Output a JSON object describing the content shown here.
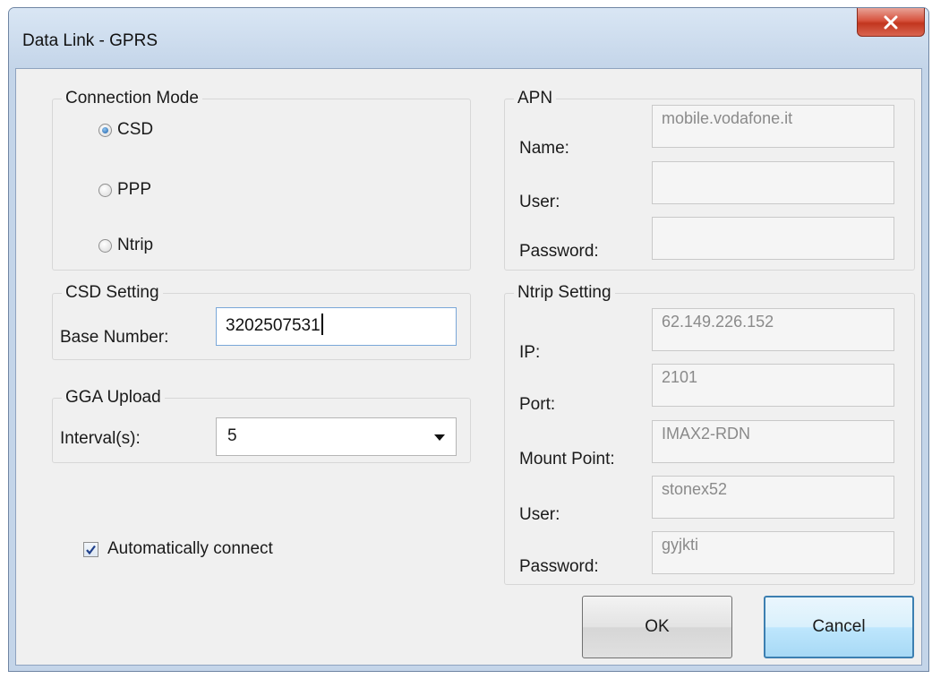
{
  "window": {
    "title": "Data Link - GPRS",
    "close_label": "x"
  },
  "connection_mode": {
    "title": "Connection Mode",
    "options": [
      {
        "label": "CSD",
        "checked": true
      },
      {
        "label": "PPP",
        "checked": false
      },
      {
        "label": "Ntrip",
        "checked": false
      }
    ]
  },
  "csd_setting": {
    "title": "CSD Setting",
    "base_number_label": "Base Number:",
    "base_number_value": "3202507531"
  },
  "gga_upload": {
    "title": "GGA Upload",
    "interval_label": "Interval(s):",
    "interval_value": "5"
  },
  "auto_connect": {
    "label": "Automatically connect",
    "checked": true
  },
  "apn": {
    "title": "APN",
    "name_label": "Name:",
    "name_value": "mobile.vodafone.it",
    "user_label": "User:",
    "user_value": "",
    "password_label": "Password:",
    "password_value": ""
  },
  "ntrip_setting": {
    "title": "Ntrip Setting",
    "ip_label": "IP:",
    "ip_value": "62.149.226.152",
    "port_label": "Port:",
    "port_value": "2101",
    "mount_point_label": "Mount Point:",
    "mount_point_value": "IMAX2-RDN",
    "user_label": "User:",
    "user_value": "stonex52",
    "password_label": "Password:",
    "password_value": "gyjkti"
  },
  "buttons": {
    "ok_label": "OK",
    "cancel_label": "Cancel"
  },
  "colors": {
    "title_bar": "#c4d5e9",
    "client_bg": "#f0f0f0",
    "close_button": "#c2361f",
    "default_button_border": "#3c7fb1"
  }
}
